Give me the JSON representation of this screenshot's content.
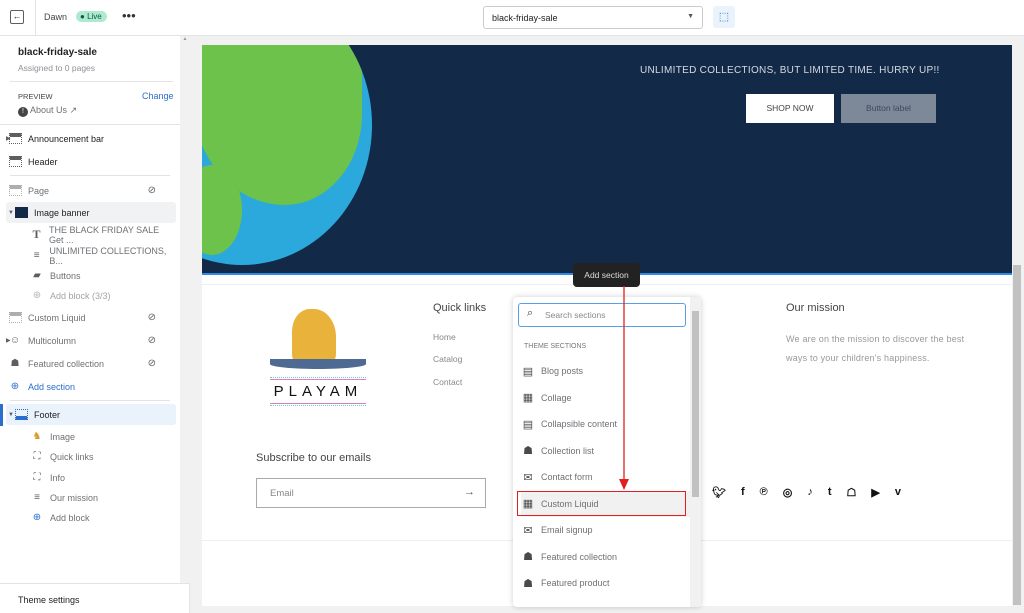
{
  "topbar": {
    "theme": "Dawn",
    "status": "Live",
    "template": "black-friday-sale"
  },
  "sidebar": {
    "template_name": "black-friday-sale",
    "assigned": "Assigned to 0 pages",
    "preview_label": "PREVIEW",
    "preview_page": "About Us",
    "change": "Change",
    "header_items": [
      {
        "label": "Announcement bar"
      },
      {
        "label": "Header"
      }
    ],
    "sections": [
      {
        "label": "Page"
      },
      {
        "label": "Image banner"
      }
    ],
    "banner_blocks": [
      {
        "label": "THE BLACK FRIDAY SALE Get ..."
      },
      {
        "label": "UNLIMITED COLLECTIONS, B..."
      },
      {
        "label": "Buttons"
      },
      {
        "label": "Add block (3/3)"
      }
    ],
    "more_sections": [
      {
        "label": "Custom Liquid"
      },
      {
        "label": "Multicolumn"
      },
      {
        "label": "Featured collection"
      }
    ],
    "add_section": "Add section",
    "footer": "Footer",
    "footer_blocks": [
      {
        "label": "Image"
      },
      {
        "label": "Quick links"
      },
      {
        "label": "Info"
      },
      {
        "label": "Our mission"
      }
    ],
    "add_block": "Add block",
    "theme_settings": "Theme settings"
  },
  "banner": {
    "subtitle": "UNLIMITED COLLECTIONS, BUT LIMITED TIME. HURRY UP!!",
    "btn1": "SHOP NOW",
    "btn2": "Button label"
  },
  "footer": {
    "logo_text": "PLAYAM",
    "quick_links_title": "Quick links",
    "links": [
      "Home",
      "Catalog",
      "Contact"
    ],
    "mission_title": "Our mission",
    "mission_text": "We are on the mission to discover the best ways to your children's happiness.",
    "subscribe": "Subscribe to our emails",
    "email_placeholder": "Email",
    "social": [
      "twitter",
      "facebook",
      "pinterest",
      "instagram",
      "tiktok",
      "tumblr",
      "snapchat",
      "youtube",
      "vimeo"
    ]
  },
  "tooltip": "Add section",
  "picker": {
    "search_placeholder": "Search sections",
    "heading": "THEME SECTIONS",
    "items": [
      {
        "label": "Blog posts",
        "icon": "blog-icon"
      },
      {
        "label": "Collage",
        "icon": "section-icon"
      },
      {
        "label": "Collapsible content",
        "icon": "text-icon"
      },
      {
        "label": "Collection list",
        "icon": "tag-icon"
      },
      {
        "label": "Contact form",
        "icon": "mail-icon"
      },
      {
        "label": "Custom Liquid",
        "icon": "section-icon"
      },
      {
        "label": "Email signup",
        "icon": "mail-icon"
      },
      {
        "label": "Featured collection",
        "icon": "tag-icon"
      },
      {
        "label": "Featured product",
        "icon": "tag-icon"
      }
    ]
  },
  "colors": {
    "accent": "#2c6ecb",
    "banner_bg": "#122a47",
    "live": "#aee9d1",
    "highlight": "#e02020"
  }
}
